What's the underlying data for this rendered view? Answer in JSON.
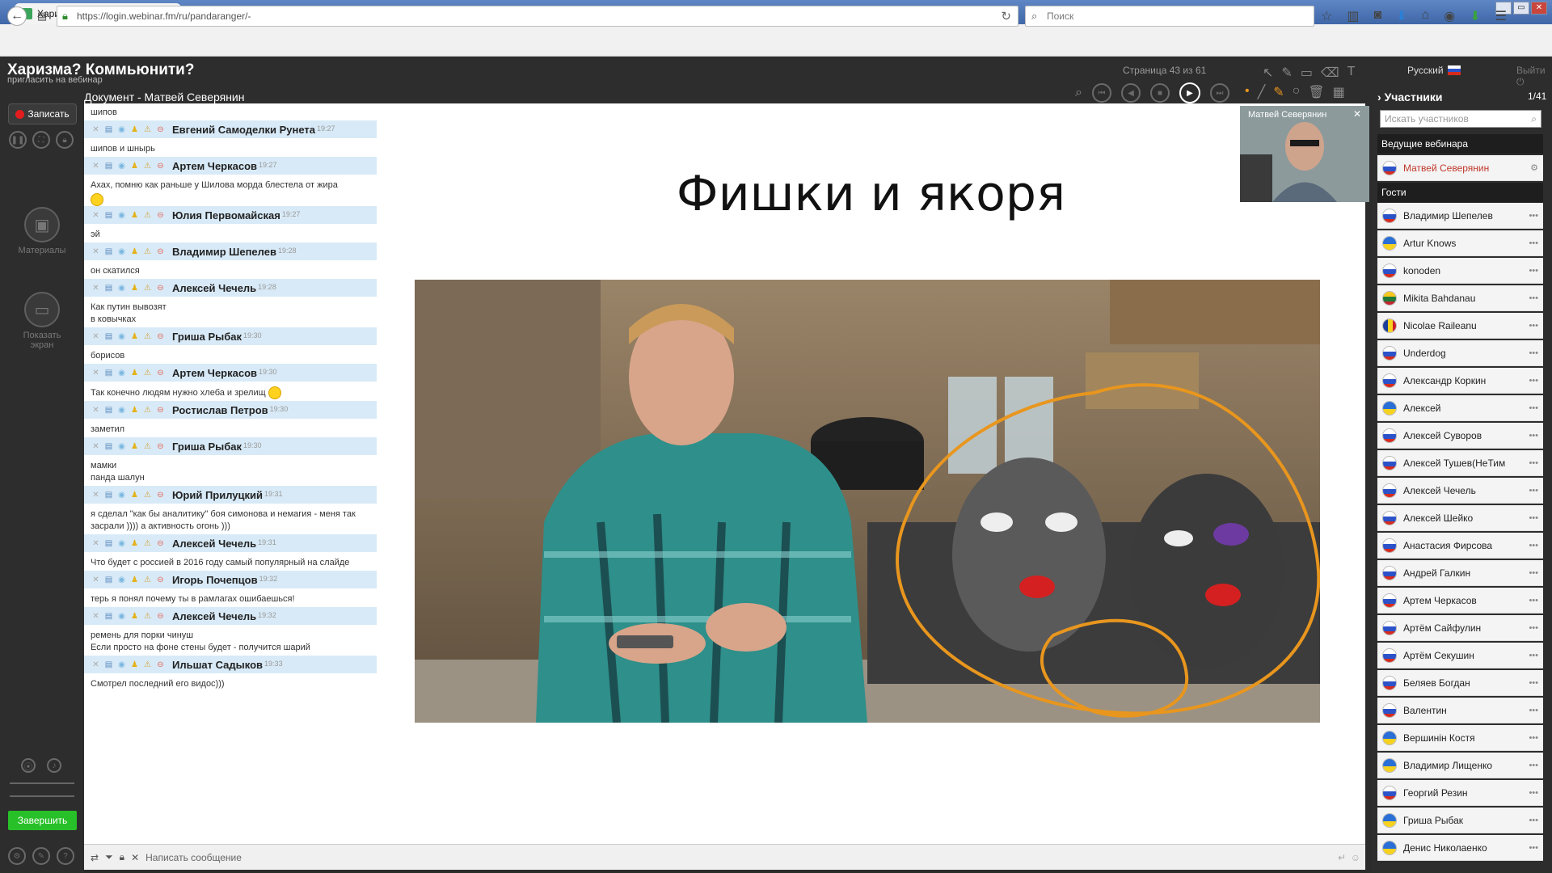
{
  "browser": {
    "tab_title": "Харизма? Коммьюнити?",
    "url": "https://login.webinar.fm/ru/pandaranger/-",
    "search_placeholder": "Поиск"
  },
  "app": {
    "title": "Харизма? Коммьюнити?",
    "invite_link": "пригласить на вебинар",
    "document_title": "Документ - Матвей Северянин",
    "page_indicator": "Страница 43 из 61",
    "language": "Русский",
    "exit_label": "Выйти"
  },
  "left_sidebar": {
    "record_label": "Записать",
    "materials_label": "Материалы",
    "show_screen_label": "Показать экран",
    "finish_label": "Завершить"
  },
  "chat": {
    "input_placeholder": "Написать сообщение",
    "messages": [
      {
        "text": "шипов",
        "author": "Евгений Самоделки Рунета",
        "time": "19:27"
      },
      {
        "text": "шипов и шнырь",
        "author": "Артем Черкасов",
        "time": "19:27"
      },
      {
        "text": "Ахах, помню как раньше у Шилова морда блестела от жира",
        "author": "Юлия Первомайская",
        "time": "19:27",
        "emoji": true
      },
      {
        "text": "эй",
        "author": "Владимир Шепелев",
        "time": "19:28"
      },
      {
        "text": "он скатился",
        "author": "Алексей Чечель",
        "time": "19:28"
      },
      {
        "text": "Как путин вывозят\nв ковычках",
        "author": "Гриша Рыбак",
        "time": "19:30"
      },
      {
        "text": "борисов",
        "author": "Артем Черкасов",
        "time": "19:30"
      },
      {
        "text": "Так конечно людям нужно хлеба и зрелищ",
        "author": "Ростислав Петров",
        "time": "19:30",
        "emoji_inline": true
      },
      {
        "text": "заметил",
        "author": "Гриша Рыбак",
        "time": "19:30"
      },
      {
        "text": "мамки\nпанда шалун",
        "author": "Юрий Прилуцкий",
        "time": "19:31"
      },
      {
        "text": "я сделал \"как бы аналитику\" боя симонова и немагия - меня так засрали )))) а активность огонь )))",
        "author": "Алексей Чечель",
        "time": "19:31"
      },
      {
        "text": "Что будет с россией в 2016 году самый популярный на слайде",
        "author": "Игорь Почепцов",
        "time": "19:32"
      },
      {
        "text": "терь я понял почему ты в рамлагах ошибаешься!",
        "author": "Алексей Чечель",
        "time": "19:32"
      },
      {
        "text": "ремень для порки чинуш\nЕсли просто на фоне стены будет - получится шарий",
        "author": "Ильшат Садыков",
        "time": "19:33"
      },
      {
        "text": "Смотрел последний его видос)))",
        "author": "",
        "time": ""
      }
    ]
  },
  "slide": {
    "title": "Фишки и якоря"
  },
  "camera": {
    "presenter_name": "Матвей Северянин"
  },
  "participants": {
    "title": "Участники",
    "count": "1/41",
    "search_placeholder": "Искать участников",
    "hosts_label": "Ведущие вебинара",
    "guests_label": "Гости",
    "hosts": [
      {
        "name": "Матвей Северянин",
        "flag": "ru"
      }
    ],
    "guests": [
      {
        "name": "Владимир Шепелев",
        "flag": "ru"
      },
      {
        "name": "Artur Knows",
        "flag": "ua"
      },
      {
        "name": "konoden",
        "flag": "ru"
      },
      {
        "name": "Mikita Bahdanau",
        "flag": "lt"
      },
      {
        "name": "Nicolae Raileanu",
        "flag": "ro"
      },
      {
        "name": "Underdog",
        "flag": "ru"
      },
      {
        "name": "Александр Коркин",
        "flag": "ru"
      },
      {
        "name": "Алексей",
        "flag": "ua"
      },
      {
        "name": "Алексей Суворов",
        "flag": "ru"
      },
      {
        "name": "Алексей Тушев(НеТим",
        "flag": "ru"
      },
      {
        "name": "Алексей Чечель",
        "flag": "ru"
      },
      {
        "name": "Алексей Шейко",
        "flag": "ru"
      },
      {
        "name": "Анастасия Фирсова",
        "flag": "ru"
      },
      {
        "name": "Андрей Галкин",
        "flag": "ru"
      },
      {
        "name": "Артем Черкасов",
        "flag": "ru"
      },
      {
        "name": "Артём Сайфулин",
        "flag": "ru"
      },
      {
        "name": "Артём Секушин",
        "flag": "ru"
      },
      {
        "name": "Беляев Богдан",
        "flag": "ru"
      },
      {
        "name": "Валентин",
        "flag": "ru"
      },
      {
        "name": "Вершинін Костя",
        "flag": "ua"
      },
      {
        "name": "Владимир Лищенко",
        "flag": "ua"
      },
      {
        "name": "Георгий Резин",
        "flag": "ru"
      },
      {
        "name": "Гриша Рыбак",
        "flag": "ua"
      },
      {
        "name": "Денис Николаенко",
        "flag": "ua"
      }
    ]
  },
  "colors": {
    "accent_green": "#28c028",
    "record_red": "#e31d1d",
    "chat_meta_bg": "#d8eaf7",
    "host_name": "#c0392b",
    "annotation_orange": "#e8961e"
  }
}
